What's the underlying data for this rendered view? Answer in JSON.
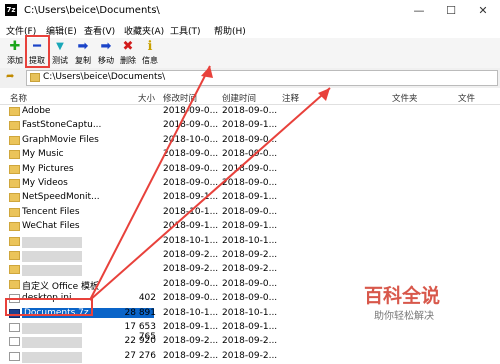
{
  "window": {
    "title": "C:\\Users\\beice\\Documents\\",
    "app_icon_text": "7z"
  },
  "menu": [
    "文件(F)",
    "编辑(E)",
    "查看(V)",
    "收藏夹(A)",
    "工具(T)",
    "帮助(H)"
  ],
  "toolbar": [
    {
      "label": "添加",
      "icon": "plus-icon",
      "glyph": "✚",
      "color": "#1aa51a"
    },
    {
      "label": "提取",
      "icon": "minus-icon",
      "glyph": "━",
      "color": "#1b44c8"
    },
    {
      "label": "测试",
      "icon": "check-icon",
      "glyph": "▼",
      "color": "#19a7b8"
    },
    {
      "label": "复制",
      "icon": "copy-arrow-icon",
      "glyph": "➡",
      "color": "#1b44c8"
    },
    {
      "label": "移动",
      "icon": "move-arrow-icon",
      "glyph": "➡",
      "color": "#1b44c8"
    },
    {
      "label": "删除",
      "icon": "delete-icon",
      "glyph": "✖",
      "color": "#d21c1c"
    },
    {
      "label": "信息",
      "icon": "info-icon",
      "glyph": "ℹ",
      "color": "#c9a100"
    }
  ],
  "address": {
    "path": "C:\\Users\\beice\\Documents\\"
  },
  "columns": {
    "name": "名称",
    "size": "大小",
    "modified": "修改时间",
    "created": "创建时间",
    "comment": "注释",
    "folders": "文件夹",
    "files": "文件"
  },
  "files": [
    {
      "name": "Adobe",
      "size": "",
      "modified": "2018-09-0...",
      "created": "2018-09-0...",
      "type": "folder"
    },
    {
      "name": "FastStoneCaptu...",
      "size": "",
      "modified": "2018-09-0...",
      "created": "2018-09-1...",
      "type": "folder"
    },
    {
      "name": "GraphMovie Files",
      "size": "",
      "modified": "2018-10-0...",
      "created": "2018-09-0...",
      "type": "folder"
    },
    {
      "name": "My Music",
      "size": "",
      "modified": "2018-09-0...",
      "created": "2018-09-0...",
      "type": "folder"
    },
    {
      "name": "My Pictures",
      "size": "",
      "modified": "2018-09-0...",
      "created": "2018-09-0...",
      "type": "folder"
    },
    {
      "name": "My Videos",
      "size": "",
      "modified": "2018-09-0...",
      "created": "2018-09-0...",
      "type": "folder"
    },
    {
      "name": "NetSpeedMonit...",
      "size": "",
      "modified": "2018-09-1...",
      "created": "2018-09-1...",
      "type": "folder"
    },
    {
      "name": "Tencent Files",
      "size": "",
      "modified": "2018-10-1...",
      "created": "2018-09-0...",
      "type": "folder"
    },
    {
      "name": "WeChat Files",
      "size": "",
      "modified": "2018-09-1...",
      "created": "2018-09-1...",
      "type": "folder"
    },
    {
      "name": "",
      "size": "",
      "modified": "2018-10-1...",
      "created": "2018-10-1...",
      "type": "folder"
    },
    {
      "name": "",
      "size": "",
      "modified": "2018-09-2...",
      "created": "2018-09-2...",
      "type": "folder"
    },
    {
      "name": "",
      "size": "",
      "modified": "2018-09-2...",
      "created": "2018-09-2...",
      "type": "folder"
    },
    {
      "name": "自定义 Office 模板",
      "size": "",
      "modified": "2018-09-0...",
      "created": "2018-09-0...",
      "type": "folder"
    },
    {
      "name": "desktop.ini",
      "size": "402",
      "modified": "2018-09-0...",
      "created": "2018-09-0...",
      "type": "file"
    },
    {
      "name": "Documents.7z",
      "size": "28 891",
      "modified": "2018-10-1...",
      "created": "2018-10-1...",
      "type": "archive",
      "selected": true
    },
    {
      "name": "",
      "size": "17 653 765",
      "modified": "2018-09-1...",
      "created": "2018-09-1...",
      "type": "file"
    },
    {
      "name": "",
      "size": "22 920",
      "modified": "2018-09-2...",
      "created": "2018-09-2...",
      "type": "file"
    },
    {
      "name": "",
      "size": "27 276",
      "modified": "2018-09-2...",
      "created": "2018-09-2...",
      "type": "file"
    }
  ],
  "watermark": {
    "title": "百科全说",
    "subtitle": "助你轻松解决"
  },
  "annotation_color": "#e8413b"
}
